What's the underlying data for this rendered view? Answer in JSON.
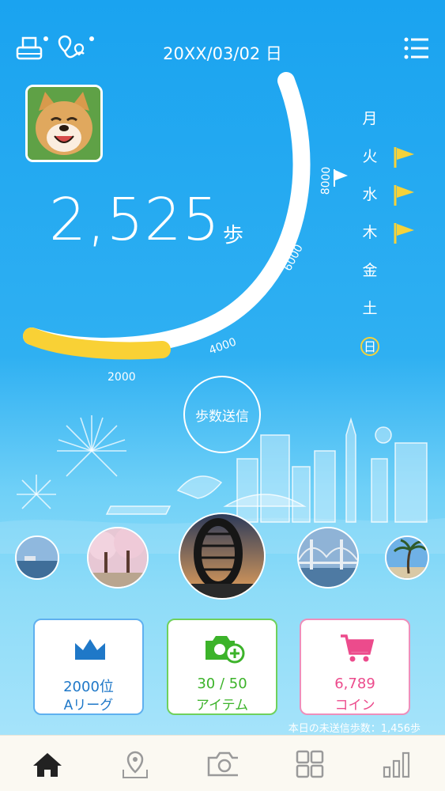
{
  "header": {
    "date": "20XX/03/02 日",
    "icons": [
      "printer-icon",
      "map-route-icon",
      "menu-icon"
    ]
  },
  "steps": {
    "count": "2,525",
    "unit": "歩",
    "goal_ratio_of_8000": 0.316
  },
  "gauge": {
    "tick_labels": [
      "2000",
      "4000",
      "6000",
      "8000"
    ]
  },
  "week": {
    "days": [
      {
        "label": "月",
        "flag": false
      },
      {
        "label": "火",
        "flag": true
      },
      {
        "label": "水",
        "flag": true
      },
      {
        "label": "木",
        "flag": true
      },
      {
        "label": "金",
        "flag": false
      },
      {
        "label": "土",
        "flag": false
      },
      {
        "label": "日",
        "flag": false,
        "today": true
      }
    ]
  },
  "send_button": "歩数送信",
  "cards": {
    "ranking": {
      "line1": "2000位",
      "line2": "Aリーグ",
      "icon": "crown-icon",
      "color": "#1f78c8"
    },
    "items": {
      "line1": "30 / 50",
      "line2": "アイテム",
      "icon": "camera-plus-icon",
      "color": "#3cb32a"
    },
    "coins": {
      "line1": "6,789",
      "line2": "コイン",
      "icon": "cart-icon",
      "color": "#ec4b8c"
    }
  },
  "unsent_text": "本日の未送信歩数：1,456歩",
  "tabs": [
    "home-icon",
    "map-pin-icon",
    "camera-icon",
    "grid-icon",
    "bar-chart-icon"
  ]
}
